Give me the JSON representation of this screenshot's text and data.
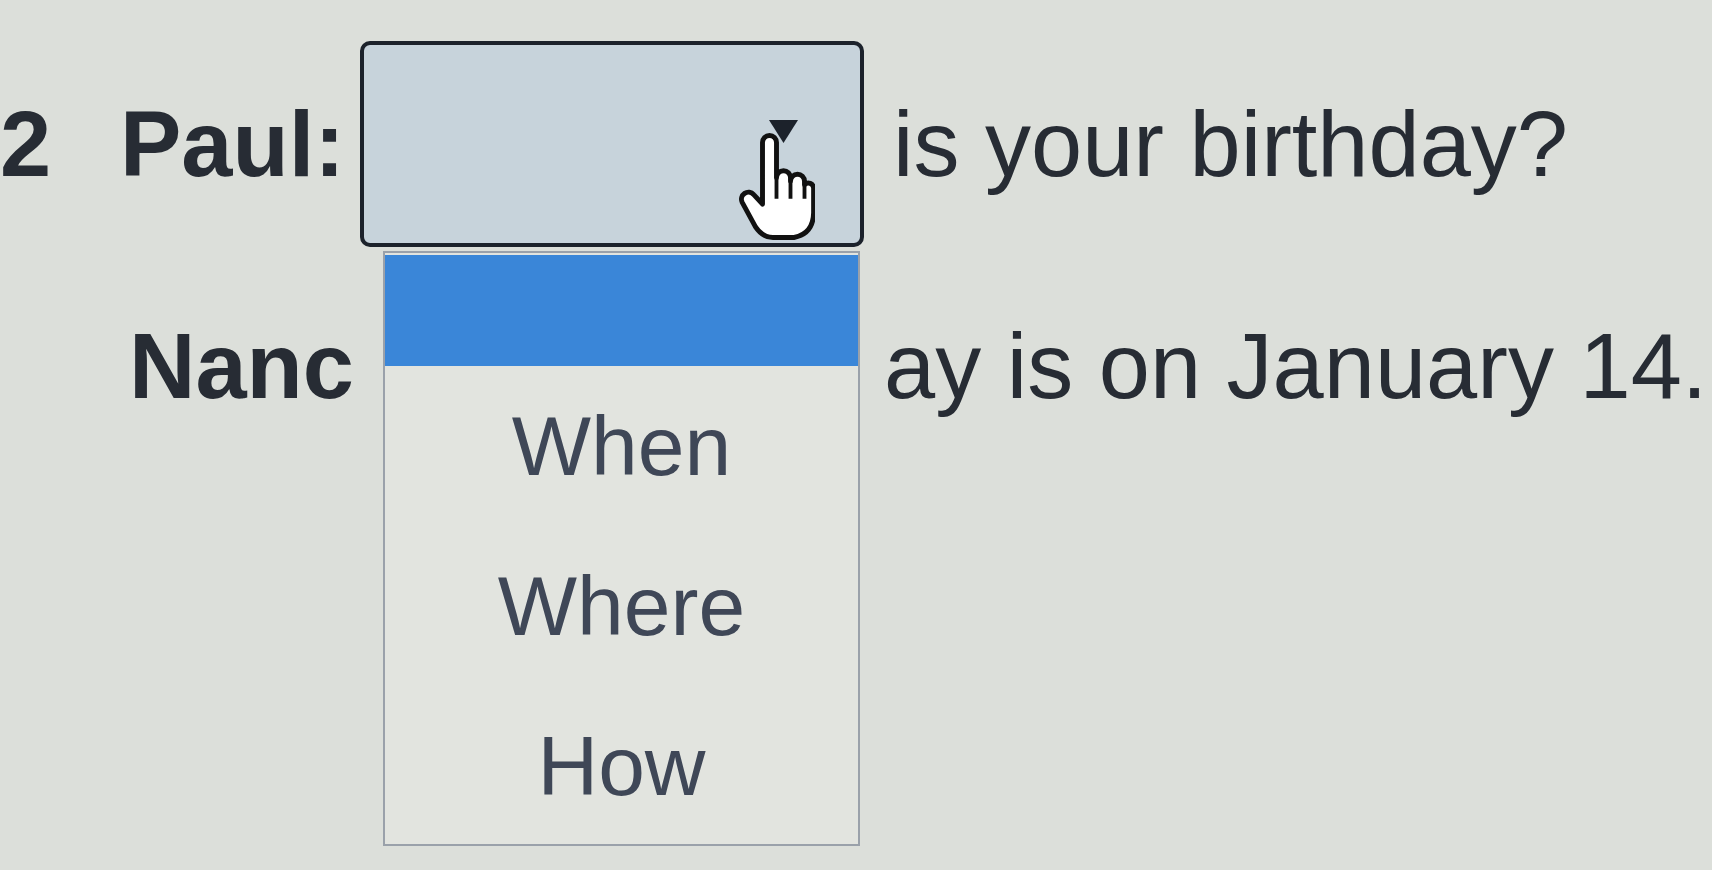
{
  "question": {
    "number": "2",
    "speaker": "Paul:",
    "after_blank": "is your birthday?"
  },
  "dropdown": {
    "open": true,
    "options": [
      {
        "selected": true
      },
      {
        "label": "When",
        "selected": false
      },
      {
        "label": "Where",
        "selected": false
      },
      {
        "label": "How",
        "selected": false
      }
    ]
  },
  "answer": {
    "speaker_visible": "Nanc",
    "text_visible": "ay is on January 14."
  }
}
